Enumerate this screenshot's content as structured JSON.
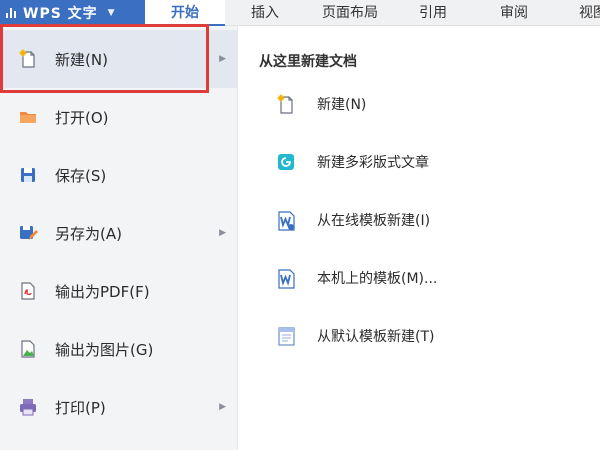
{
  "ribbon": {
    "app_name": "WPS 文字",
    "tabs": [
      "开始",
      "插入",
      "页面布局",
      "引用",
      "审阅",
      "视图"
    ],
    "active_tab": "开始"
  },
  "left_menu": {
    "items": [
      {
        "label": "新建(N)",
        "icon": "new-doc-icon",
        "has_submenu": true,
        "selected": true
      },
      {
        "label": "打开(O)",
        "icon": "folder-icon",
        "has_submenu": false
      },
      {
        "label": "保存(S)",
        "icon": "save-icon",
        "has_submenu": false
      },
      {
        "label": "另存为(A)",
        "icon": "save-as-icon",
        "has_submenu": true
      },
      {
        "label": "输出为PDF(F)",
        "icon": "pdf-export-icon",
        "has_submenu": false
      },
      {
        "label": "输出为图片(G)",
        "icon": "image-export-icon",
        "has_submenu": false
      },
      {
        "label": "打印(P)",
        "icon": "printer-icon",
        "has_submenu": true
      }
    ]
  },
  "right_panel": {
    "title": "从这里新建文档",
    "options": [
      {
        "label": "新建(N)",
        "icon": "new-doc-icon"
      },
      {
        "label": "新建多彩版式文章",
        "icon": "colorful-layout-icon"
      },
      {
        "label": "从在线模板新建(I)",
        "icon": "online-template-icon"
      },
      {
        "label": "本机上的模板(M)...",
        "icon": "local-template-icon"
      },
      {
        "label": "从默认模板新建(T)",
        "icon": "default-template-icon"
      }
    ]
  },
  "colors": {
    "brand": "#3b6fc2",
    "highlight": "#e03b3b"
  }
}
